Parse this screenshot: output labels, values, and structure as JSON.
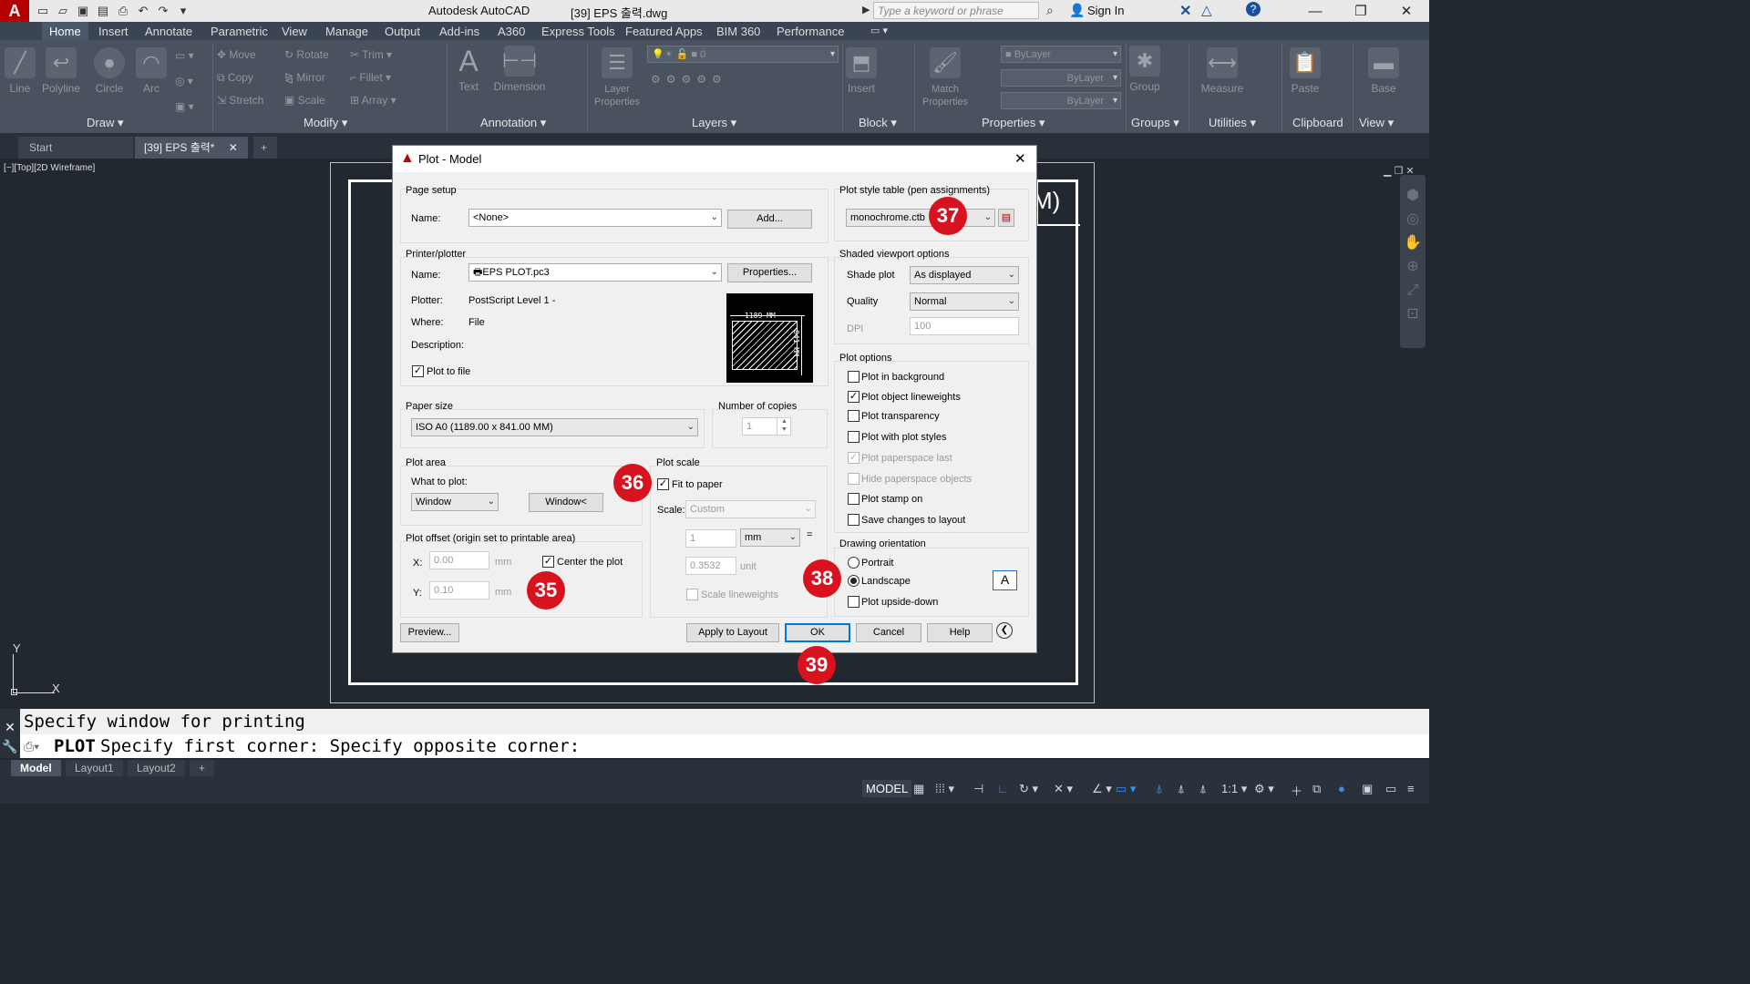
{
  "titlebar": {
    "app_title": "Autodesk AutoCAD",
    "doc_title": "[39] EPS 출력.dwg",
    "search_placeholder": "Type a keyword or phrase",
    "sign_in": "Sign In"
  },
  "ribbon_tabs": [
    "Home",
    "Insert",
    "Annotate",
    "Parametric",
    "View",
    "Manage",
    "Output",
    "Add-ins",
    "A360",
    "Express Tools",
    "Featured Apps",
    "BIM 360",
    "Performance"
  ],
  "ribbon": {
    "draw": {
      "label": "Draw",
      "tools": [
        "Line",
        "Polyline",
        "Circle",
        "Arc"
      ]
    },
    "modify": {
      "label": "Modify",
      "tools": [
        "Move",
        "Rotate",
        "Trim",
        "Copy",
        "Mirror",
        "Fillet",
        "Stretch",
        "Scale",
        "Array"
      ]
    },
    "annotation": {
      "label": "Annotation",
      "tools": [
        "Text",
        "Dimension"
      ]
    },
    "layers": {
      "label": "Layers",
      "tools": [
        "Layer Properties"
      ],
      "current_layer": "0"
    },
    "block": {
      "label": "Block",
      "tools": [
        "Insert"
      ]
    },
    "properties": {
      "label": "Properties",
      "tools": [
        "Match Properties"
      ],
      "color": "ByLayer",
      "linetype": "ByLayer",
      "lineweight": "ByLayer"
    },
    "groups": {
      "label": "Groups",
      "tools": [
        "Group"
      ]
    },
    "utilities": {
      "label": "Utilities",
      "tools": [
        "Measure"
      ]
    },
    "clipboard": {
      "label": "Clipboard",
      "tools": [
        "Paste"
      ]
    },
    "view": {
      "label": "View",
      "tools": [
        "Base"
      ]
    }
  },
  "doc_tabs": [
    "Start",
    "[39] EPS 출력*"
  ],
  "viewport_label": "[−][Top][2D Wireframe]",
  "drawing_partial_text": "M)",
  "ucs": {
    "y": "Y",
    "x": "X"
  },
  "command": {
    "history": "Specify window for printing",
    "prompt_cmd": "PLOT",
    "prompt_text": "Specify first corner: Specify opposite corner:"
  },
  "layout_tabs": [
    "Model",
    "Layout1",
    "Layout2"
  ],
  "status": {
    "model": "MODEL",
    "scale": "1:1"
  },
  "dialog": {
    "title": "Plot - Model",
    "page_setup": {
      "group": "Page setup",
      "name_label": "Name:",
      "name_value": "<None>",
      "add_btn": "Add..."
    },
    "printer": {
      "group": "Printer/plotter",
      "name_label": "Name:",
      "name_value": "EPS PLOT.pc3",
      "properties_btn": "Properties...",
      "plotter_label": "Plotter:",
      "plotter_value": "PostScript Level 1 -",
      "where_label": "Where:",
      "where_value": "File",
      "desc_label": "Description:",
      "plot_to_file": "Plot to file",
      "preview_width": "1189 MM",
      "preview_height": "841 MM"
    },
    "paper_size": {
      "group": "Paper size",
      "value": "ISO A0 (1189.00 x 841.00 MM)"
    },
    "copies": {
      "group": "Number of copies",
      "value": "1"
    },
    "plot_area": {
      "group": "Plot area",
      "what_label": "What to plot:",
      "what_value": "Window",
      "window_btn": "Window<"
    },
    "plot_offset": {
      "group": "Plot offset (origin set to printable area)",
      "x_label": "X:",
      "x_value": "0.00",
      "y_label": "Y:",
      "y_value": "0.10",
      "unit": "mm",
      "center": "Center the plot"
    },
    "plot_scale": {
      "group": "Plot scale",
      "fit": "Fit to paper",
      "scale_label": "Scale:",
      "scale_value": "Custom",
      "val1": "1",
      "unit1": "mm",
      "eq": "=",
      "val2": "0.3532",
      "unit2": "unit",
      "lineweights": "Scale lineweights"
    },
    "plot_style": {
      "group": "Plot style table (pen assignments)",
      "value": "monochrome.ctb"
    },
    "shaded": {
      "group": "Shaded viewport options",
      "shade_label": "Shade plot",
      "shade_value": "As displayed",
      "quality_label": "Quality",
      "quality_value": "Normal",
      "dpi_label": "DPI",
      "dpi_value": "100"
    },
    "plot_options": {
      "group": "Plot options",
      "items": [
        "Plot in background",
        "Plot object lineweights",
        "Plot transparency",
        "Plot with plot styles",
        "Plot paperspace last",
        "Hide paperspace objects",
        "Plot stamp on",
        "Save changes to layout"
      ]
    },
    "orientation": {
      "group": "Drawing orientation",
      "portrait": "Portrait",
      "landscape": "Landscape",
      "upside": "Plot upside-down",
      "icon_letter": "A"
    },
    "buttons": {
      "preview": "Preview...",
      "apply": "Apply to Layout",
      "ok": "OK",
      "cancel": "Cancel",
      "help": "Help"
    }
  },
  "badges": [
    "35",
    "36",
    "37",
    "38",
    "39"
  ]
}
